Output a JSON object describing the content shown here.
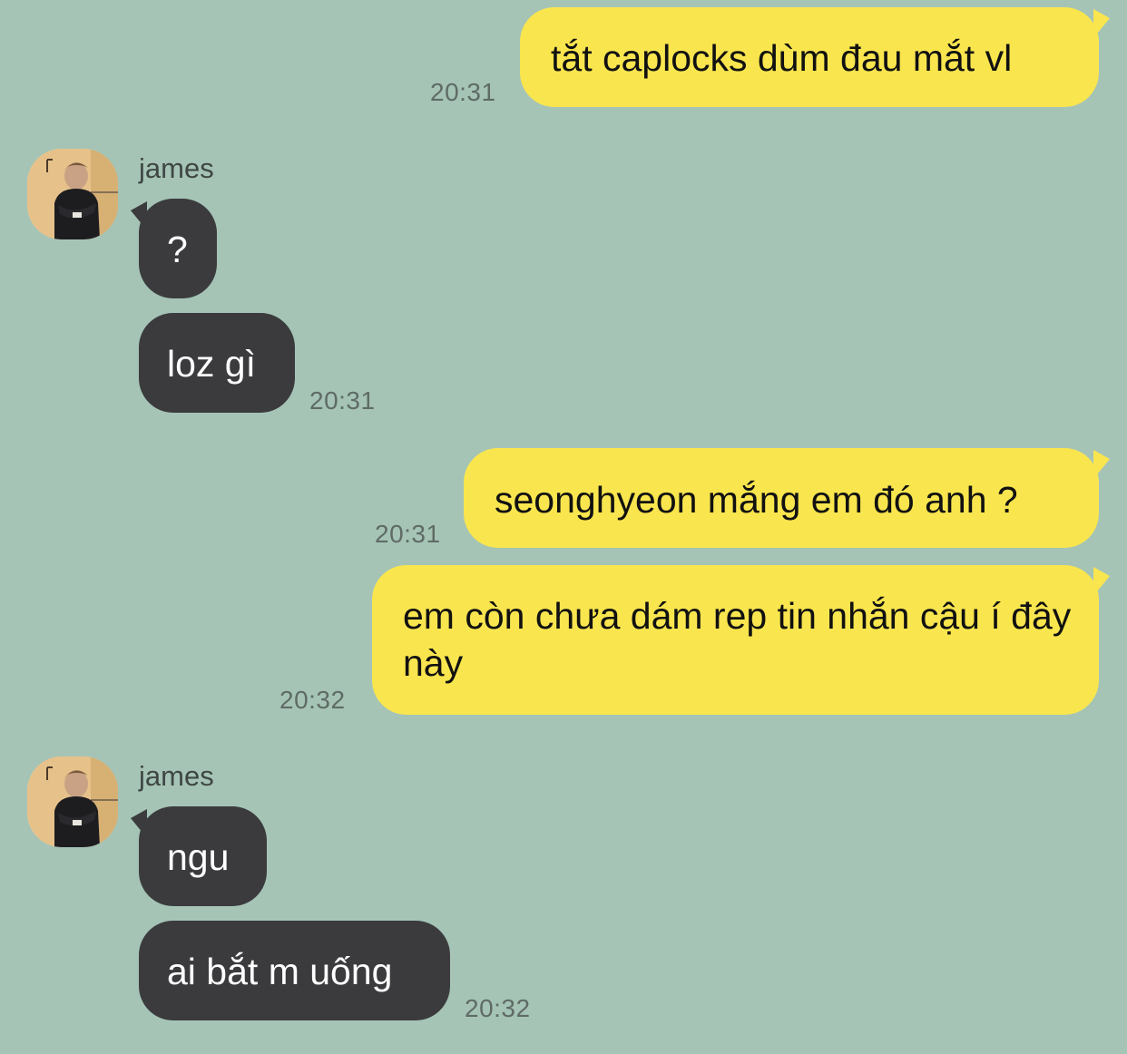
{
  "conversation": {
    "messages": [
      {
        "sender": "me",
        "text": "tắt caplocks dùm đau mắt vl",
        "time": "20:31"
      },
      {
        "sender": "james",
        "name": "james",
        "text": "?",
        "time": ""
      },
      {
        "sender": "james",
        "text": "loz gì",
        "time": "20:31"
      },
      {
        "sender": "me",
        "text": "seonghyeon mắng em đó anh ?",
        "time": "20:31"
      },
      {
        "sender": "me",
        "text": "em còn chưa dám rep tin nhắn cậu í đây này",
        "time": "20:32"
      },
      {
        "sender": "james",
        "name": "james",
        "text": "ngu",
        "time": ""
      },
      {
        "sender": "james",
        "text": "ai bắt m uống",
        "time": "20:32"
      }
    ]
  },
  "colors": {
    "background": "#a5c4b6",
    "my_bubble": "#f9e54e",
    "their_bubble": "#3b3b3e",
    "timestamp": "#5f6b66"
  },
  "icons": {
    "avatar": "avatar-photo"
  }
}
